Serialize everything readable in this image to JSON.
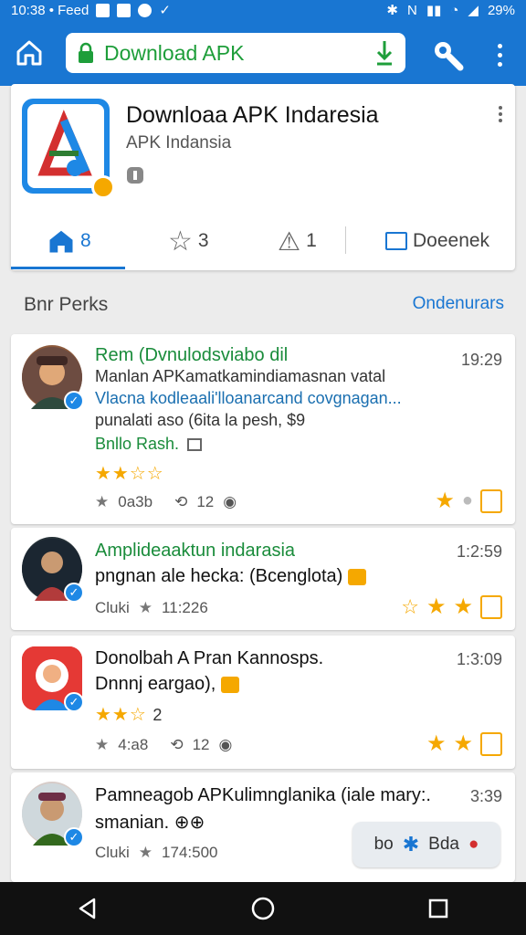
{
  "status_bar": {
    "left_text": "10:38 • Feed",
    "battery": "29%"
  },
  "toolbar": {
    "url_text": "Download APK"
  },
  "app": {
    "title": "Downloaa APK Indaresia",
    "subtitle": "APK Indansia",
    "tabs": [
      {
        "label": "8",
        "icon": "home-icon"
      },
      {
        "label": "3",
        "icon": "star-outline-icon"
      },
      {
        "label": "1",
        "icon": "warning-icon"
      },
      {
        "label": "Doeenek",
        "icon": "mail-icon"
      }
    ]
  },
  "section": {
    "title": "Bnr Perks",
    "link": "Ondenurars"
  },
  "feed": [
    {
      "line1": "Rem (Dvnulodsviabo dil",
      "line2": "Manlan APKamatkamindiamasnan vatal",
      "line3": "Vlacna kodleaali'lloanarcand covgnagan...",
      "line4": "punalati aso (6ita la pesh, $9",
      "tag": "Bnllo Rash.",
      "time": "19:29",
      "stars": "★★☆☆",
      "stat1": "0a3b",
      "stat2": "12",
      "rating": 2.5
    },
    {
      "line1": "Amplideaaktun indarasia",
      "line2": "pngnan ale hecka: (Bcenglota)",
      "meta": "Cluki",
      "count": "11:226",
      "time": "1:2:59"
    },
    {
      "line1": "Donolbah A Pran Kannosps.",
      "line2": "Dnnnj eargao),",
      "stars": "★★☆",
      "stars_count": "2",
      "stat1": "4:a8",
      "stat2": "12",
      "time": "1:3:09"
    },
    {
      "line1": "Pamneagob APKulimnglanika (iale mary:.",
      "line2": "smanian.",
      "meta": "Cluki",
      "count": "174:500",
      "time": "3:39",
      "chip_left": "bo",
      "chip_right": "Bda"
    }
  ],
  "colors": {
    "primary": "#1976d2",
    "accent_green": "#1a8c3b",
    "star": "#f5a800",
    "nav": "#111111"
  }
}
